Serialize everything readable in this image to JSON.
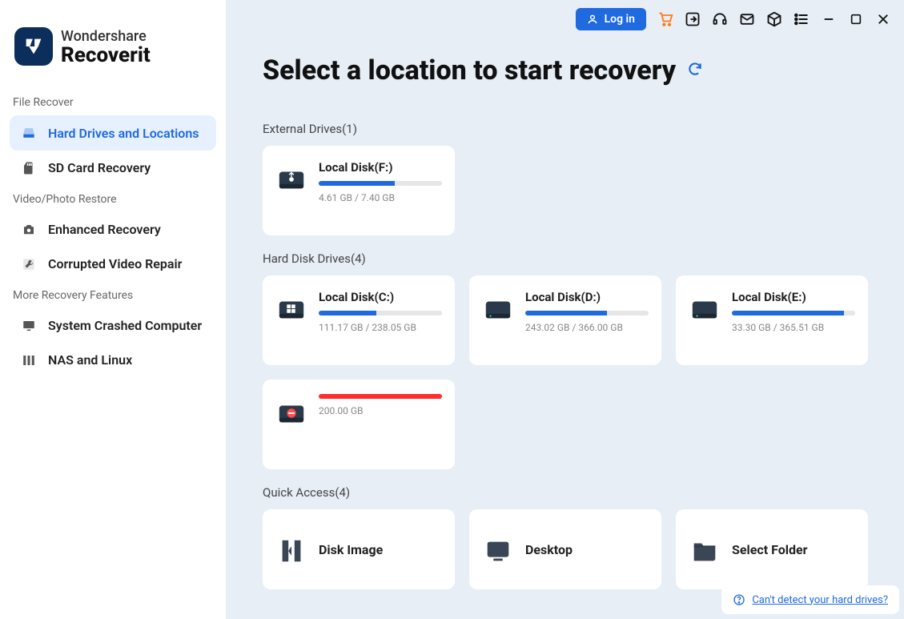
{
  "brand": {
    "line1": "Wondershare",
    "line2": "Recoverit"
  },
  "sidebar": {
    "sections": [
      {
        "label": "File Recover",
        "items": [
          {
            "id": "hard-drives",
            "label": "Hard Drives and Locations",
            "active": true
          },
          {
            "id": "sd-card",
            "label": "SD Card Recovery",
            "active": false
          }
        ]
      },
      {
        "label": "Video/Photo Restore",
        "items": [
          {
            "id": "enhanced",
            "label": "Enhanced Recovery",
            "active": false
          },
          {
            "id": "corrupted",
            "label": "Corrupted Video Repair",
            "active": false
          }
        ]
      },
      {
        "label": "More Recovery Features",
        "items": [
          {
            "id": "crashed",
            "label": "System Crashed Computer",
            "active": false
          },
          {
            "id": "nas",
            "label": "NAS and Linux",
            "active": false
          }
        ]
      }
    ]
  },
  "topbar": {
    "login": "Log in"
  },
  "page": {
    "title": "Select a location to start recovery"
  },
  "groups": {
    "external": {
      "label": "External Drives",
      "count": "(1)",
      "drives": [
        {
          "title": "Local Disk(F:)",
          "sub": "4.61 GB / 7.40 GB",
          "pct": 62,
          "icon": "usb",
          "red": false
        }
      ]
    },
    "hdd": {
      "label": "Hard Disk Drives",
      "count": "(4)",
      "drives": [
        {
          "title": "Local Disk(C:)",
          "sub": "111.17 GB / 238.05 GB",
          "pct": 47,
          "icon": "win",
          "red": false
        },
        {
          "title": "Local Disk(D:)",
          "sub": "243.02 GB / 366.00 GB",
          "pct": 66,
          "icon": "hdd",
          "red": false
        },
        {
          "title": "Local Disk(E:)",
          "sub": "33.30 GB / 365.51 GB",
          "pct": 91,
          "icon": "hdd",
          "red": false
        },
        {
          "title": "",
          "sub": "200.00 GB",
          "pct": 100,
          "icon": "err",
          "red": true
        }
      ]
    },
    "quick": {
      "label": "Quick Access",
      "count": "(4)",
      "items": [
        {
          "title": "Disk Image",
          "icon": "diskimg"
        },
        {
          "title": "Desktop",
          "icon": "desktop"
        },
        {
          "title": "Select Folder",
          "icon": "folder"
        }
      ]
    }
  },
  "footer": {
    "link": "Can't detect your hard drives?"
  }
}
